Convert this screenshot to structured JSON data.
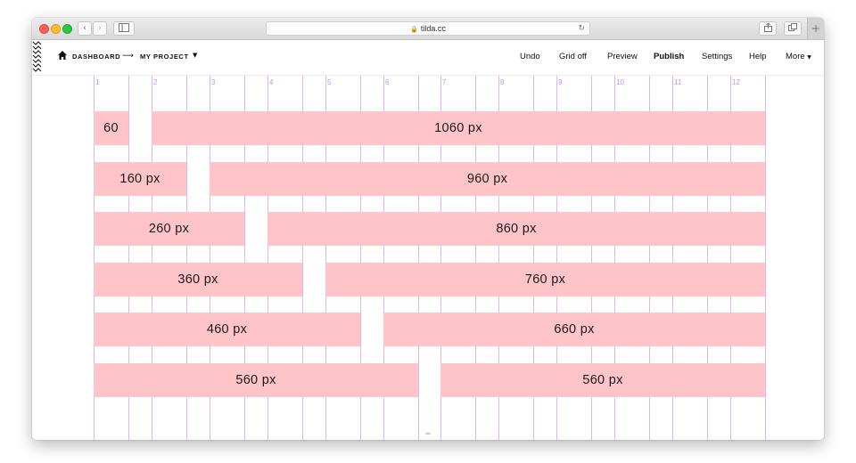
{
  "browser": {
    "url": "tilda.cc",
    "traffic_lights": [
      "close",
      "minimize",
      "zoom"
    ],
    "new_tab_label": "+"
  },
  "editor": {
    "breadcrumb": {
      "home_icon": "home-icon",
      "dashboard": "DASHBOARD",
      "arrow": "⟶",
      "project": "MY PROJECT"
    },
    "menu": {
      "undo": "Undo",
      "grid_off": "Grid off",
      "preview": "Preview",
      "publish": "Publish",
      "settings": "Settings",
      "help": "Help",
      "more": "More"
    }
  },
  "grid": {
    "columns": [
      "1",
      "2",
      "3",
      "4",
      "5",
      "6",
      "7",
      "8",
      "9",
      "10",
      "11",
      "12"
    ],
    "color": "#d9b6f4"
  },
  "rows": [
    {
      "left_label": "60",
      "right_label": "1060 px",
      "left_cols": 1
    },
    {
      "left_label": "160 px",
      "right_label": "960 px",
      "left_cols": 2
    },
    {
      "left_label": "260 px",
      "right_label": "860 px",
      "left_cols": 3
    },
    {
      "left_label": "360 px",
      "right_label": "760 px",
      "left_cols": 4
    },
    {
      "left_label": "460 px",
      "right_label": "660 px",
      "left_cols": 5
    },
    {
      "left_label": "560 px",
      "right_label": "560 px",
      "left_cols": 6
    }
  ],
  "colors": {
    "bar": "#fec4c8",
    "grid": "#d9b6f4"
  }
}
